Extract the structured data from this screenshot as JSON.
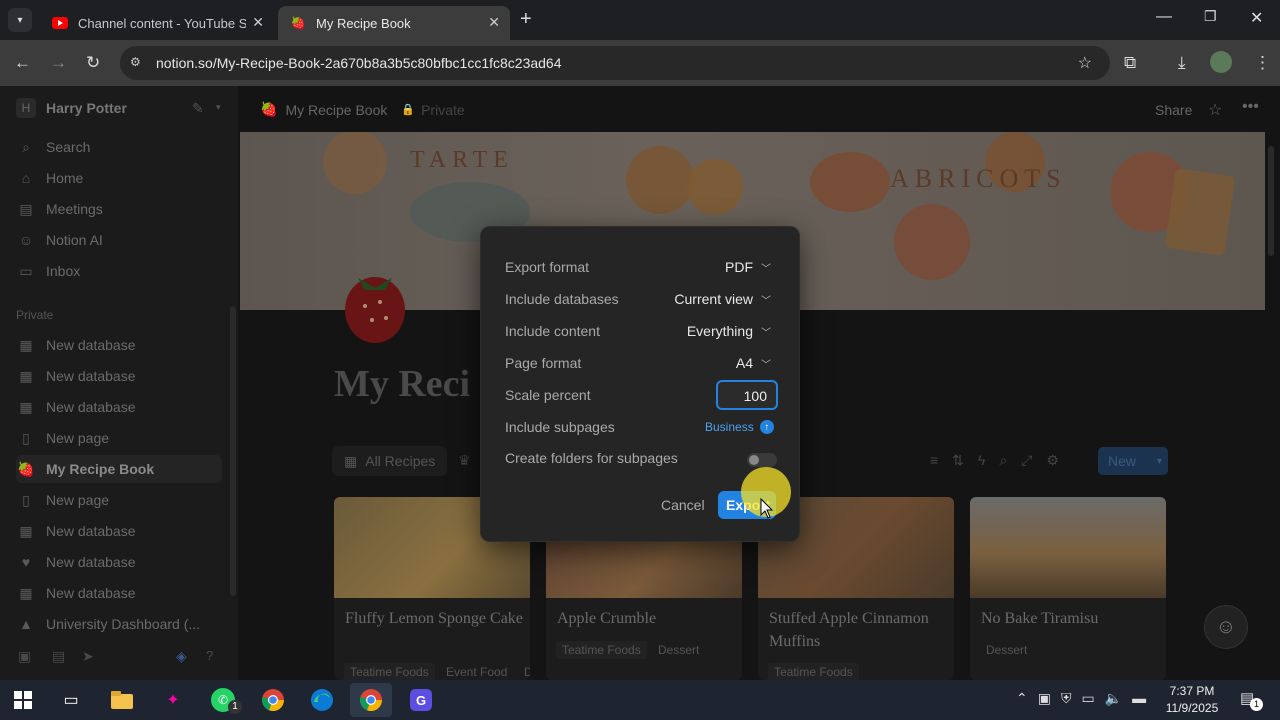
{
  "browser": {
    "tabs": [
      {
        "label": "Channel content - YouTube Stu",
        "favicon": "youtube-icon"
      },
      {
        "label": "My Recipe Book",
        "favicon": "strawberry-icon"
      }
    ],
    "url": "notion.so/My-Recipe-Book-2a670b8a3b5c80bfbc1cc1fc8c23ad64"
  },
  "sidebar": {
    "workspace_initial": "H",
    "workspace": "Harry Potter",
    "nav": [
      {
        "label": "Search",
        "icon": "search-icon"
      },
      {
        "label": "Home",
        "icon": "home-icon"
      },
      {
        "label": "Meetings",
        "icon": "meetings-icon"
      },
      {
        "label": "Notion AI",
        "icon": "ai-icon"
      },
      {
        "label": "Inbox",
        "icon": "inbox-icon"
      }
    ],
    "section_private": "Private",
    "pages": [
      {
        "label": "New database",
        "icon": "table-icon"
      },
      {
        "label": "New database",
        "icon": "table-icon"
      },
      {
        "label": "New database",
        "icon": "table-icon"
      },
      {
        "label": "New page",
        "icon": "page-icon"
      },
      {
        "label": "My Recipe Book",
        "icon": "strawberry-icon"
      },
      {
        "label": "New page",
        "icon": "page-icon"
      },
      {
        "label": "New database",
        "icon": "table-icon"
      },
      {
        "label": "New database",
        "icon": "heart-icon"
      },
      {
        "label": "New database",
        "icon": "table-icon"
      },
      {
        "label": "University Dashboard (...",
        "icon": "school-icon"
      }
    ]
  },
  "topbar": {
    "breadcrumb": "My Recipe Book",
    "privacy": "Private",
    "share": "Share"
  },
  "page": {
    "title": "My Reci",
    "view_tab": "All Recipes",
    "new_button": "New",
    "cards": [
      {
        "title": "Fluffy Lemon Sponge Cake",
        "tags": [
          "Teatime Foods",
          "Event Food",
          "D"
        ]
      },
      {
        "title": "Apple Crumble",
        "tags": [
          "Teatime Foods",
          "Dessert"
        ]
      },
      {
        "title": "Stuffed Apple Cinnamon Muffins",
        "tags": [
          "Teatime Foods"
        ]
      },
      {
        "title": "No Bake Tiramisu",
        "tags": [
          "Dessert"
        ]
      }
    ]
  },
  "export_dialog": {
    "rows": [
      {
        "label": "Export format",
        "value": "PDF"
      },
      {
        "label": "Include databases",
        "value": "Current view"
      },
      {
        "label": "Include content",
        "value": "Everything"
      },
      {
        "label": "Page format",
        "value": "A4"
      }
    ],
    "scale_label": "Scale percent",
    "scale_value": "100",
    "subpages_label": "Include subpages",
    "subpages_badge": "Business",
    "folders_label": "Create folders for subpages",
    "folders_toggle": false,
    "cancel": "Cancel",
    "export": "Export"
  },
  "taskbar": {
    "time": "7:37 PM",
    "date": "11/9/2025",
    "whatsapp_badge": "1",
    "notification_badge": "1"
  },
  "colors": {
    "accent": "#2383e2",
    "business_badge": "#4aa3f0",
    "cursor_highlight": "#f5e027"
  }
}
